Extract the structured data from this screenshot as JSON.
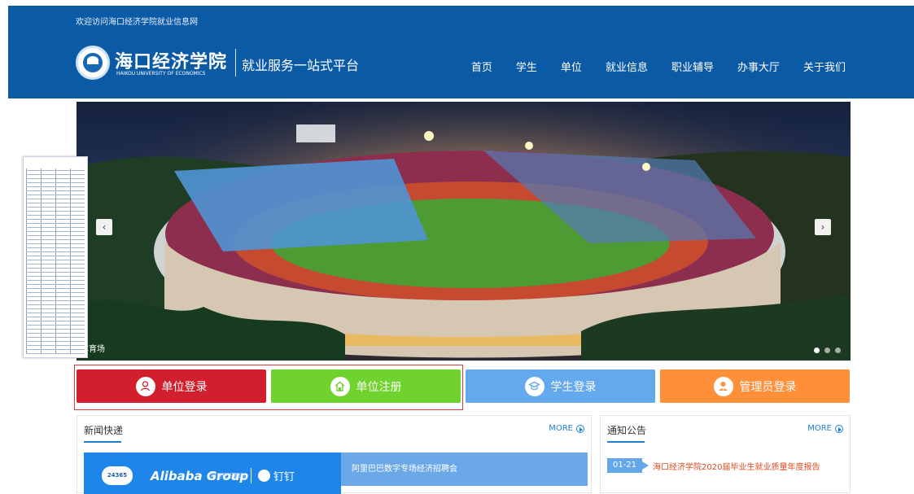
{
  "site": {
    "welcome": "欢迎访问海口经济学院就业信息网",
    "logo_cn": "海口经济学院",
    "logo_en": "HAIKOU UNIVERSITY OF ECONOMICS",
    "platform": "就业服务一站式平台"
  },
  "nav": {
    "items": [
      "首页",
      "学生",
      "单位",
      "就业信息",
      "职业辅导",
      "办事大厅",
      "关于我们"
    ]
  },
  "banner": {
    "caption": "体育场",
    "prev_icon": "chevron-left-icon",
    "next_icon": "chevron-right-icon",
    "active_index": 0,
    "slide_count": 3
  },
  "login": {
    "items": [
      {
        "label": "单位登录",
        "color": "#d11f2d",
        "icon": "user-icon"
      },
      {
        "label": "单位注册",
        "color": "#6fd22d",
        "icon": "home-icon"
      },
      {
        "label": "学生登录",
        "color": "#64a9ee",
        "icon": "graduation-icon"
      },
      {
        "label": "管理员登录",
        "color": "#ff8f39",
        "icon": "admin-icon"
      }
    ]
  },
  "news": {
    "title": "新闻快递",
    "more": "MORE",
    "headline": "阿里巴巴数字专场经济招聘会",
    "image_badge": "24365",
    "image_brand": "Alibaba Group",
    "image_brand_sub": "阿里巴巴集团",
    "image_partner": "钉钉"
  },
  "notice": {
    "title": "通知公告",
    "more": "MORE",
    "item_date": "01-21",
    "item_title": "海口经济学院2020届毕业生就业质量年度报告"
  }
}
